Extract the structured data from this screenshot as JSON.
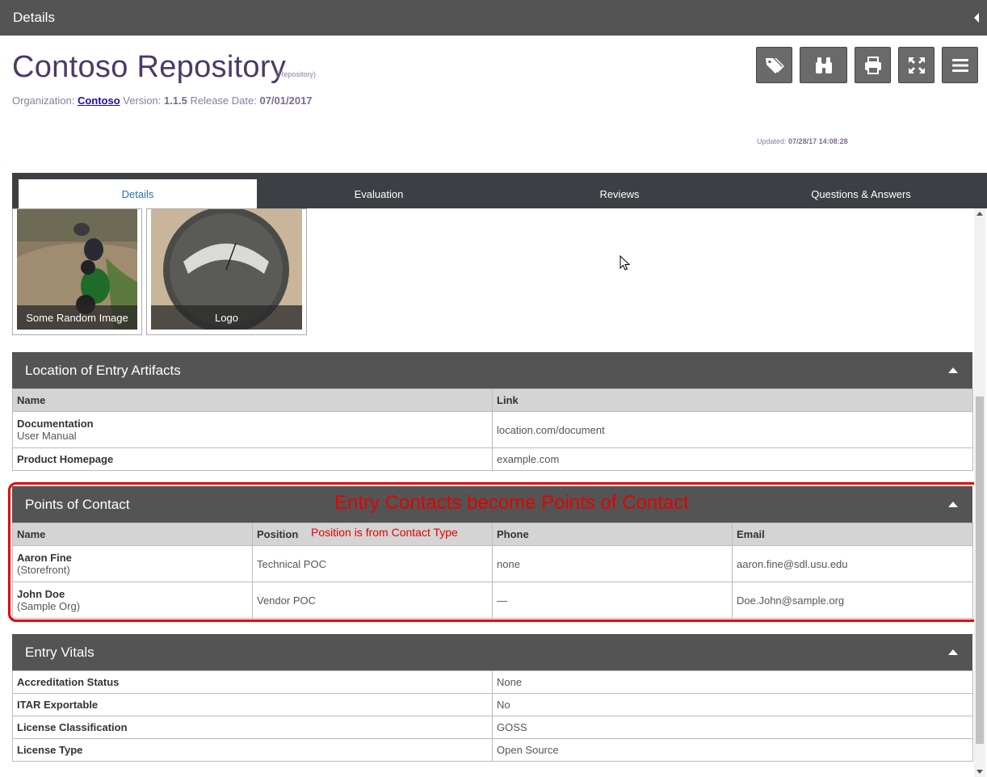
{
  "topbar": {
    "title": "Details"
  },
  "entry": {
    "title": "Contoso Repository",
    "type": "(Repository)",
    "org_label": "Organization:",
    "org_value": "Contoso",
    "version_label": "Version:",
    "version_value": "1.1.5",
    "release_label": "Release Date:",
    "release_value": "07/01/2017",
    "updated_label": "Updated:",
    "updated_value": "07/28/17 14:08:28"
  },
  "toolbar": {
    "buttons": [
      {
        "name": "tags",
        "icon": "tags-icon"
      },
      {
        "name": "watch",
        "icon": "binoculars-icon"
      },
      {
        "name": "print",
        "icon": "print-icon"
      },
      {
        "name": "fullscreen",
        "icon": "expand-icon"
      },
      {
        "name": "menu",
        "icon": "menu-icon"
      }
    ]
  },
  "tabs": [
    "Details",
    "Evaluation",
    "Reviews",
    "Questions & Answers"
  ],
  "media": [
    {
      "caption": "Some Random Image"
    },
    {
      "caption": "Logo"
    }
  ],
  "artifacts": {
    "title": "Location of Entry Artifacts",
    "headers": [
      "Name",
      "Link"
    ],
    "rows": [
      {
        "name": "Documentation",
        "sub": "User Manual",
        "link": "location.com/document"
      },
      {
        "name": "Product Homepage",
        "sub": "",
        "link": "example.com"
      }
    ]
  },
  "contacts": {
    "title": "Points of Contact",
    "headers": [
      "Name",
      "Position",
      "Phone",
      "Email"
    ],
    "rows": [
      {
        "name": "Aaron Fine",
        "org": "(Storefront)",
        "position": "Technical POC",
        "phone": "none",
        "email": "aaron.fine@sdl.usu.edu"
      },
      {
        "name": "John Doe",
        "org": "(Sample Org)",
        "position": "Vendor POC",
        "phone": "—",
        "email": "Doe.John@sample.org"
      }
    ]
  },
  "annotations": {
    "big": "Entry Contacts become Points of Contact",
    "small": "Position is from Contact Type"
  },
  "vitals": {
    "title": "Entry Vitals",
    "rows": [
      {
        "label": "Accreditation Status",
        "value": "None"
      },
      {
        "label": "ITAR Exportable",
        "value": "No"
      },
      {
        "label": "License Classification",
        "value": "GOSS"
      },
      {
        "label": "License Type",
        "value": "Open Source"
      }
    ]
  },
  "colors": {
    "accent": "#4b3a63",
    "annotation": "#e60000",
    "header": "#545454",
    "tabs": "#3c3f44"
  }
}
